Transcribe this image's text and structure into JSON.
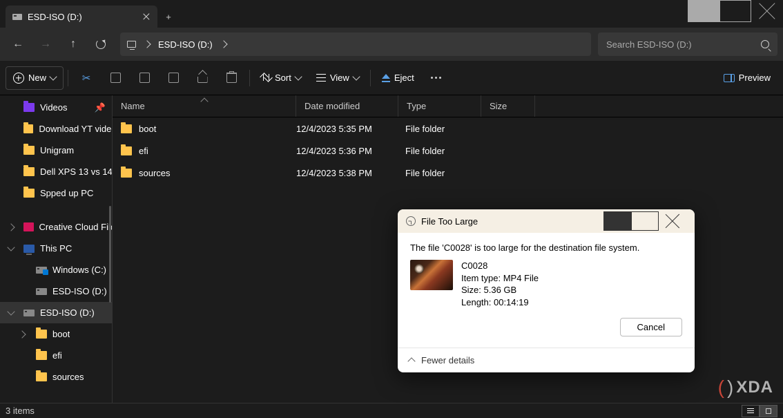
{
  "tab": {
    "title": "ESD-ISO (D:)"
  },
  "address": {
    "location": "ESD-ISO (D:)"
  },
  "search": {
    "placeholder": "Search ESD-ISO (D:)"
  },
  "toolbar": {
    "new": "New",
    "sort": "Sort",
    "view": "View",
    "eject": "Eject",
    "preview": "Preview"
  },
  "sidebar": {
    "items": [
      {
        "label": "Videos",
        "icon": "vid",
        "pinned": true,
        "depth": 1
      },
      {
        "label": "Download YT videos",
        "icon": "f",
        "depth": 1
      },
      {
        "label": "Unigram",
        "icon": "f",
        "depth": 1
      },
      {
        "label": "Dell XPS 13 vs 14",
        "icon": "f",
        "depth": 1
      },
      {
        "label": "Spped up PC",
        "icon": "f",
        "depth": 1
      }
    ],
    "group2": [
      {
        "label": "Creative Cloud Files",
        "icon": "cc",
        "exp": "r",
        "depth": 1
      },
      {
        "label": "This PC",
        "icon": "pc",
        "exp": "d",
        "depth": 1
      },
      {
        "label": "Windows (C:)",
        "icon": "drvwin",
        "depth": 2
      },
      {
        "label": "ESD-ISO (D:)",
        "icon": "drv",
        "depth": 2
      },
      {
        "label": "ESD-ISO (D:)",
        "icon": "drv",
        "exp": "d",
        "depth": 1,
        "sel": true
      },
      {
        "label": "boot",
        "icon": "f",
        "exp": "r",
        "depth": 2
      },
      {
        "label": "efi",
        "icon": "f",
        "depth": 2
      },
      {
        "label": "sources",
        "icon": "f",
        "depth": 2
      }
    ]
  },
  "columns": {
    "name": "Name",
    "date": "Date modified",
    "type": "Type",
    "size": "Size"
  },
  "rows": [
    {
      "name": "boot",
      "date": "12/4/2023 5:35 PM",
      "type": "File folder",
      "size": ""
    },
    {
      "name": "efi",
      "date": "12/4/2023 5:36 PM",
      "type": "File folder",
      "size": ""
    },
    {
      "name": "sources",
      "date": "12/4/2023 5:38 PM",
      "type": "File folder",
      "size": ""
    }
  ],
  "status": {
    "text": "3 items"
  },
  "dialog": {
    "title": "File Too Large",
    "message": "The file 'C0028' is too large for the destination file system.",
    "file": {
      "name": "C0028",
      "itemtype_label": "Item type: MP4 File",
      "size_label": "Size: 5.36 GB",
      "length_label": "Length: 00:14:19"
    },
    "cancel": "Cancel",
    "fewer": "Fewer details"
  },
  "watermark": "XDA"
}
